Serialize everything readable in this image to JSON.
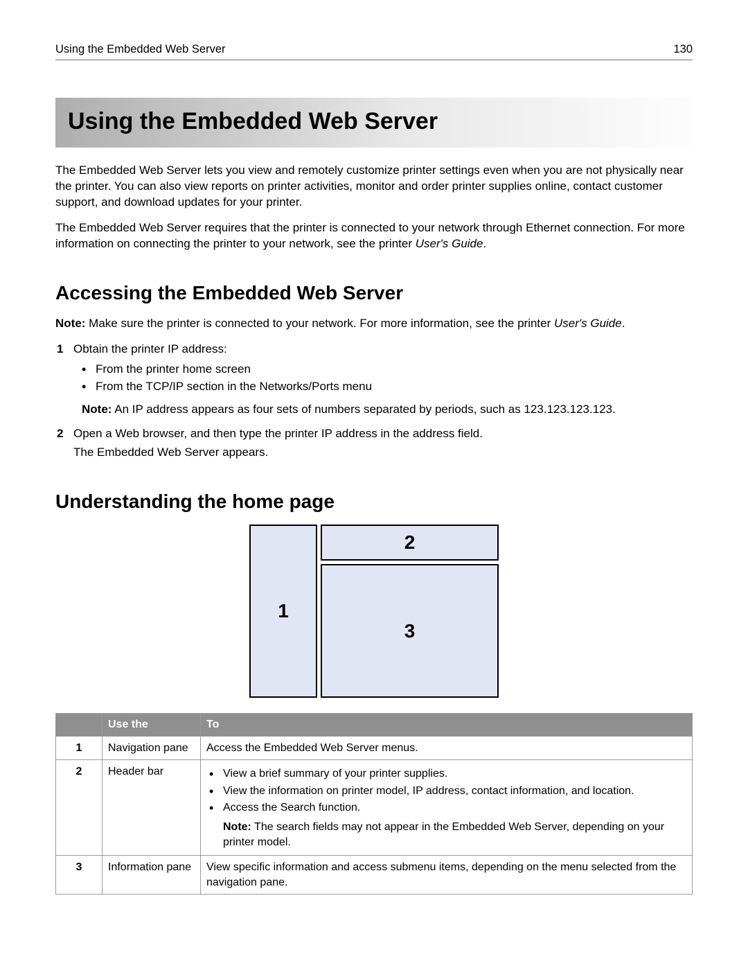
{
  "header": {
    "left": "Using the Embedded Web Server",
    "right": "130"
  },
  "title": "Using the Embedded Web Server",
  "intro": {
    "p1": "The Embedded Web Server lets you view and remotely customize printer settings even when you are not physically near the printer. You can also view reports on printer activities, monitor and order printer supplies online, contact customer support, and download updates for your printer.",
    "p2a": "The Embedded Web Server requires that the printer is connected to your network through Ethernet connection. For more information on connecting the printer to your network, see the printer ",
    "p2i": "User's Guide",
    "p2b": "."
  },
  "access": {
    "heading": "Accessing the Embedded Web Server",
    "note_label": "Note:",
    "note_a": " Make sure the printer is connected to your network. For more information, see the printer ",
    "note_i": "User's Guide",
    "note_b": ".",
    "step1": "Obtain the printer IP address:",
    "step1_b1": "From the printer home screen",
    "step1_b2": "From the TCP/IP section in the Networks/Ports menu",
    "step1_note_label": "Note:",
    "step1_note": " An IP address appears as four sets of numbers separated by periods, such as 123.123.123.123.",
    "step2": "Open a Web browser, and then type the printer IP address in the address field.",
    "step2_sub": "The Embedded Web Server appears."
  },
  "home": {
    "heading": "Understanding the home page",
    "diag1": "1",
    "diag2": "2",
    "diag3": "3"
  },
  "table": {
    "h_blank": "",
    "h_use": "Use the",
    "h_to": "To",
    "rows": [
      {
        "n": "1",
        "use": "Navigation pane",
        "to": "Access the Embedded Web Server menus."
      },
      {
        "n": "2",
        "use": "Header bar",
        "b1": "View a brief summary of your printer supplies.",
        "b2": "View the information on printer model, IP address, contact information, and location.",
        "b3": "Access the Search function.",
        "note_label": "Note:",
        "note": " The search fields may not appear in the Embedded Web Server, depending on your printer model."
      },
      {
        "n": "3",
        "use": "Information pane",
        "to": "View specific information and access submenu items, depending on the menu selected from the navigation pane."
      }
    ]
  }
}
